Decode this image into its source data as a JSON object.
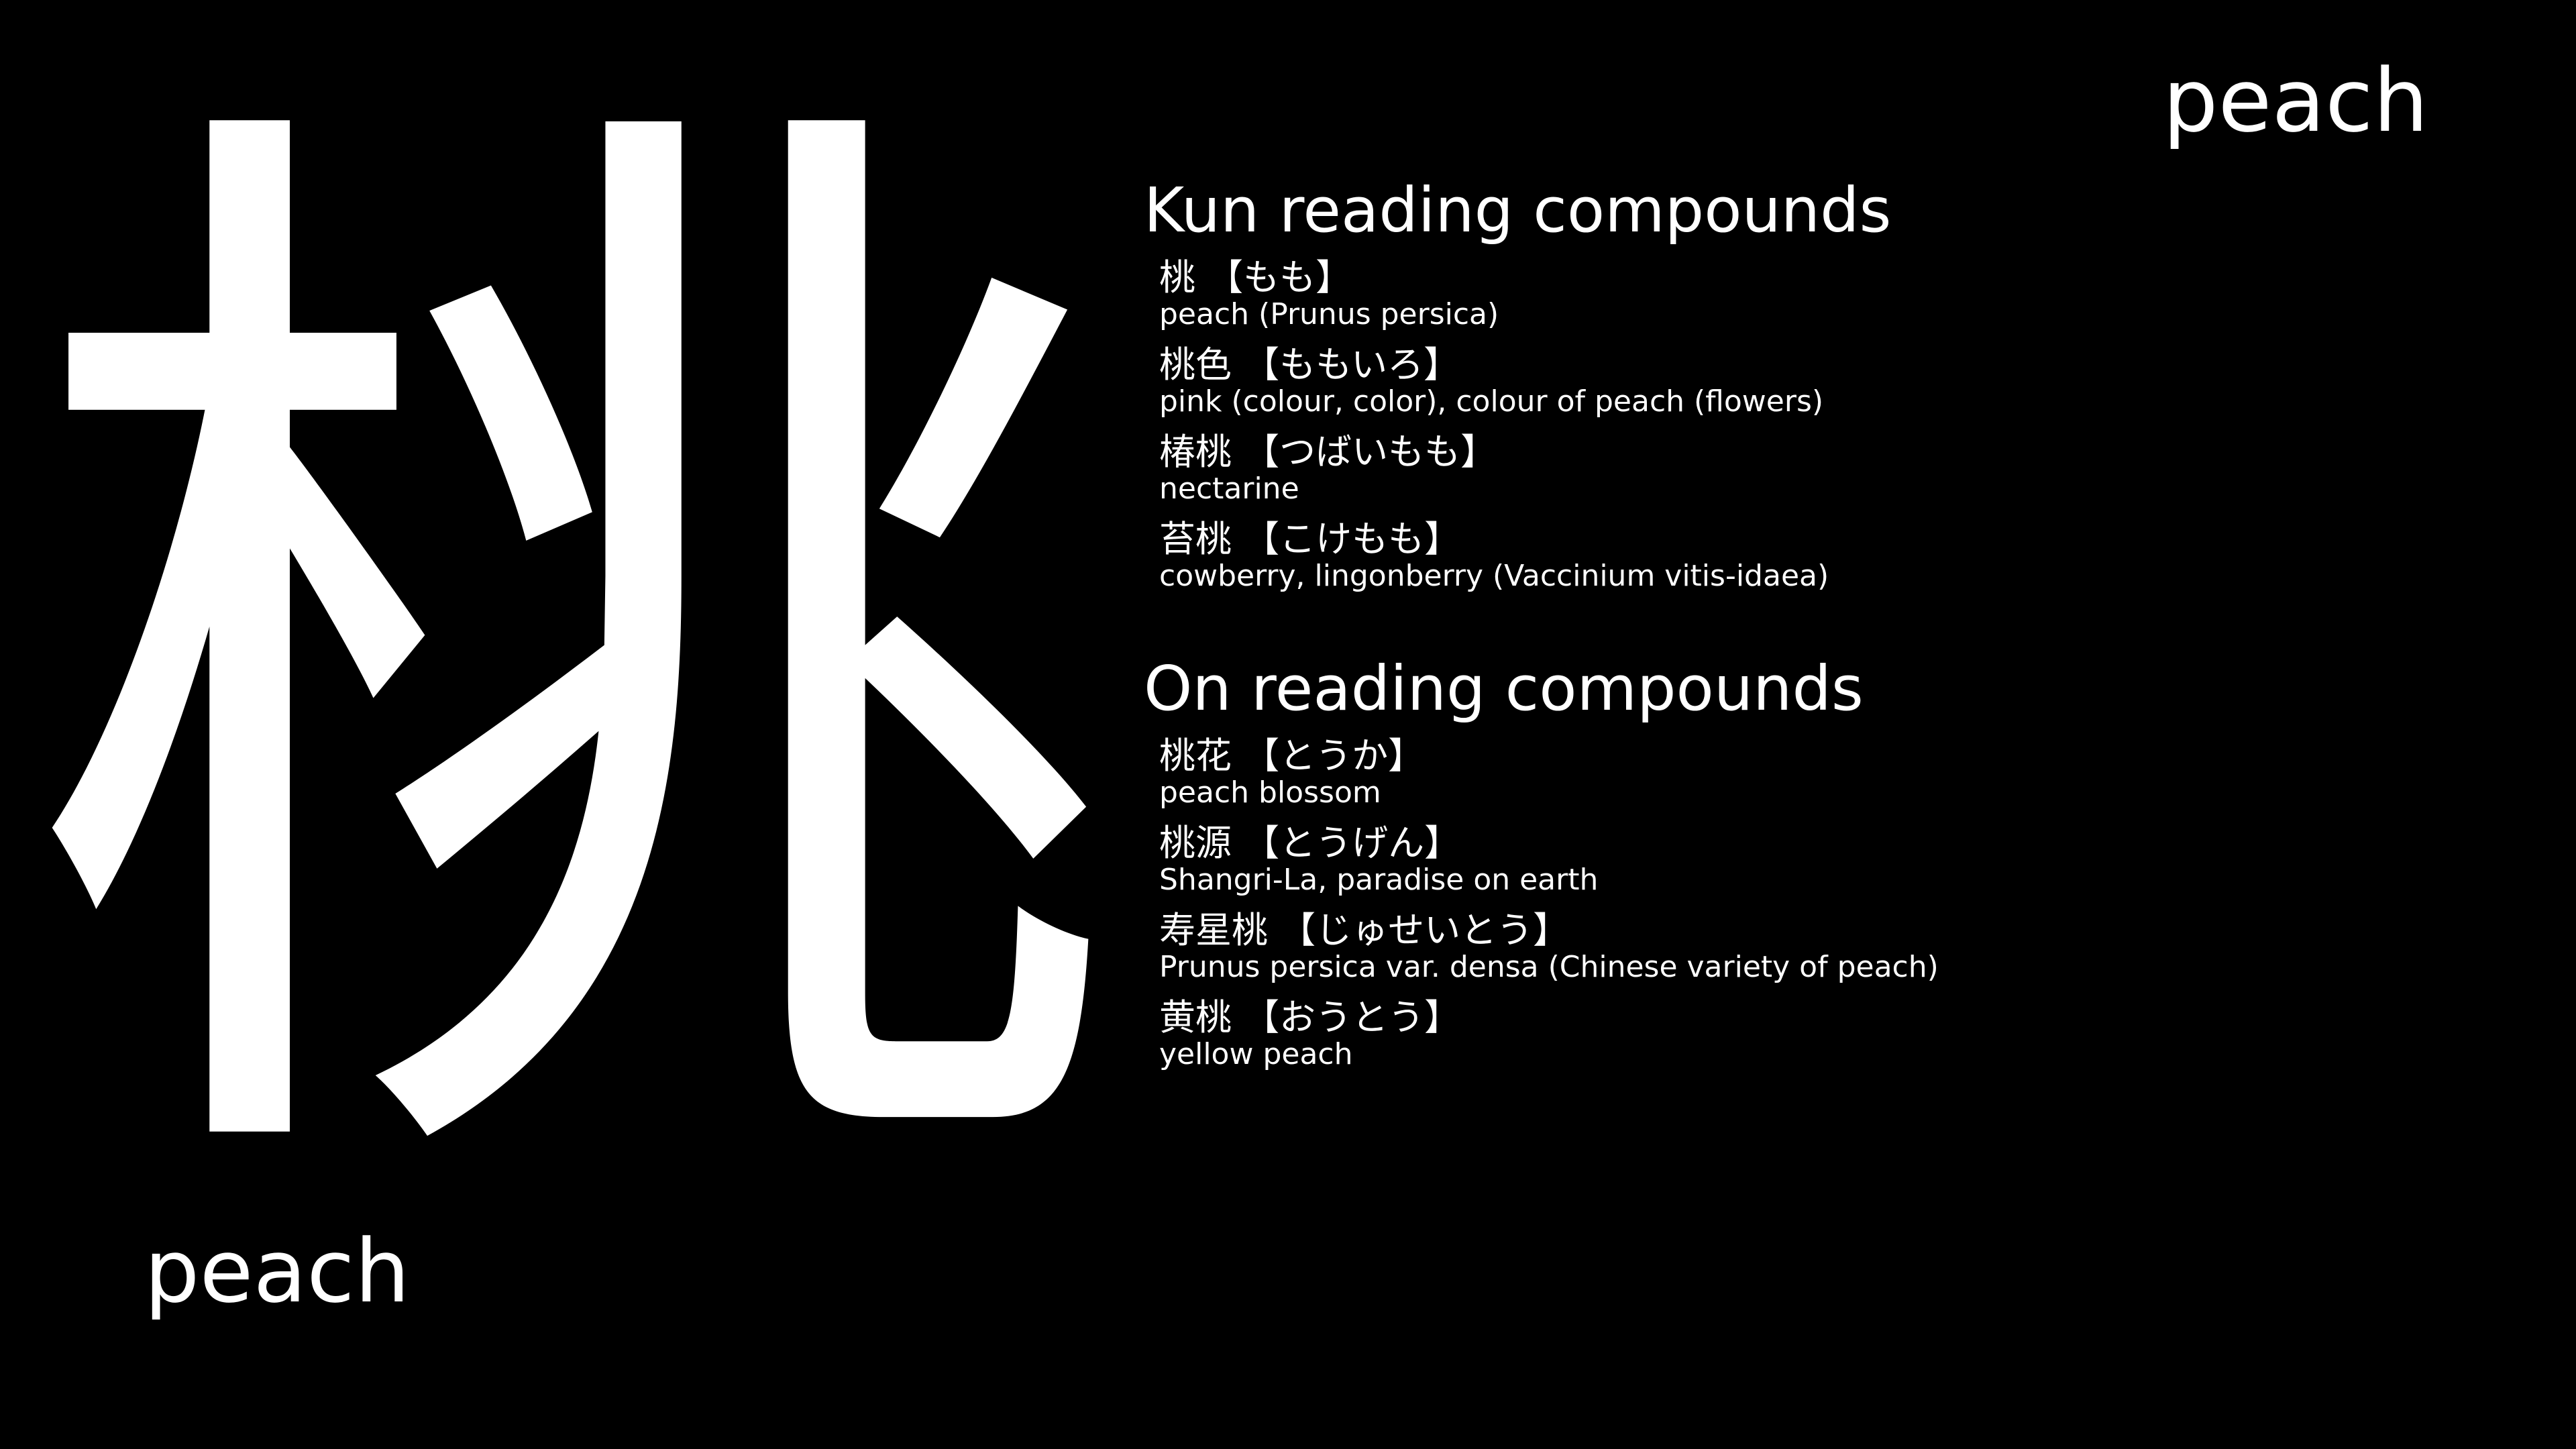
{
  "kanji": {
    "character": "桃",
    "meaning": "peach"
  },
  "header": {
    "meaning": "peach"
  },
  "kun": {
    "title": "Kun reading compounds",
    "entries": [
      {
        "word": "桃 【もも】",
        "definition": "peach (Prunus persica)"
      },
      {
        "word": "桃色 【ももいろ】",
        "definition": "pink (colour, color), colour of peach (flowers)"
      },
      {
        "word": "椿桃 【つばいもも】",
        "definition": "nectarine"
      },
      {
        "word": "苔桃 【こけもも】",
        "definition": "cowberry, lingonberry (Vaccinium vitis-idaea)"
      }
    ]
  },
  "on": {
    "title": "On reading compounds",
    "entries": [
      {
        "word": "桃花 【とうか】",
        "definition": "peach blossom"
      },
      {
        "word": "桃源 【とうげん】",
        "definition": "Shangri-La, paradise on earth"
      },
      {
        "word": "寿星桃 【じゅせいとう】",
        "definition": "Prunus persica var. densa (Chinese variety of peach)"
      },
      {
        "word": "黄桃 【おうとう】",
        "definition": "yellow peach"
      }
    ]
  },
  "colors": {
    "background": "#000000",
    "text": "#ffffff"
  }
}
